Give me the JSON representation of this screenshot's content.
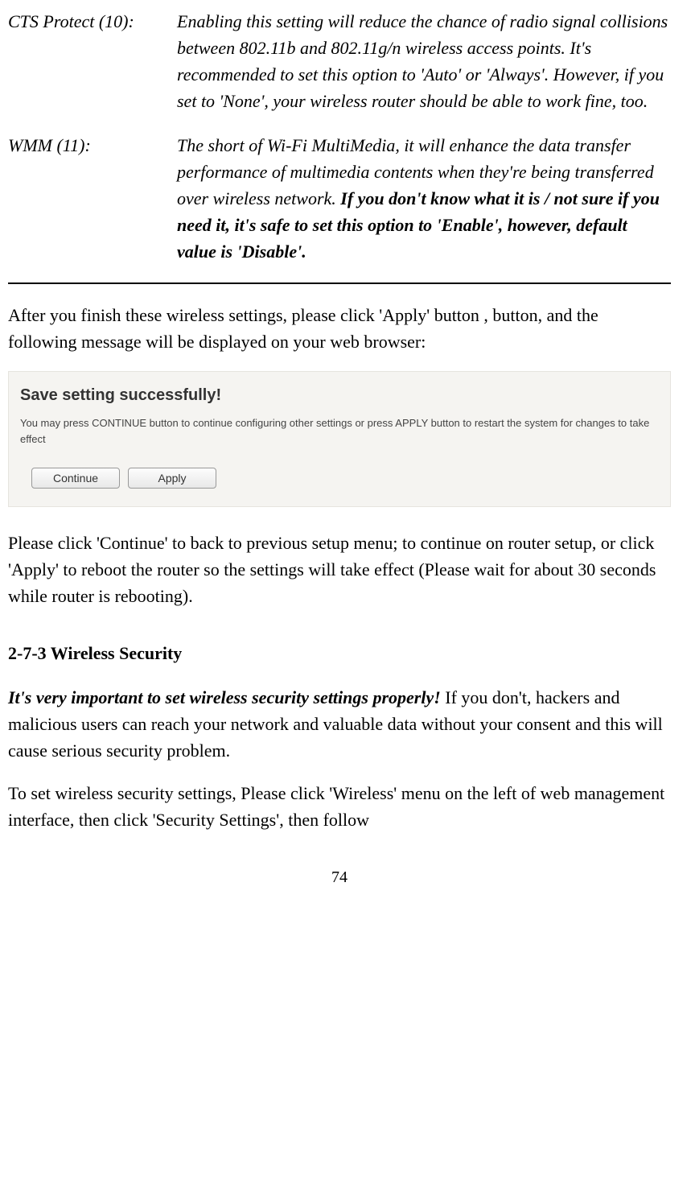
{
  "defs": {
    "cts": {
      "label": "CTS Protect (10):",
      "body": "Enabling this setting will reduce the chance of radio signal collisions between 802.11b and 802.11g/n wireless access points. It's recommended to set this option to 'Auto' or 'Always'. However, if you set to 'None', your wireless router should be able to work fine, too."
    },
    "wmm": {
      "label": "WMM (11):",
      "body_plain": "The short of Wi-Fi MultiMedia, it will enhance the data transfer performance of multimedia contents when they're being transferred over wireless network. ",
      "body_bold": "If you don't know what it is / not sure if you need it, it's safe to set this option to 'Enable', however, default value is 'Disable'."
    }
  },
  "para1": "After you finish these wireless settings, please click 'Apply' button , button, and the following message will be displayed on your web browser:",
  "panel": {
    "title": "Save setting successfully!",
    "text": "You may press CONTINUE button to continue configuring other settings or press APPLY button to restart the system for changes to take effect",
    "continue_label": "Continue",
    "apply_label": "Apply"
  },
  "para2": "Please click 'Continue' to back to previous setup menu; to continue on router setup, or click 'Apply' to reboot the router so the settings will take effect (Please wait for about 30 seconds while router is rebooting).",
  "section_heading": "2-7-3 Wireless Security",
  "para3_bold": "It's very important to set wireless security settings properly!",
  "para3_rest": " If you don't, hackers and malicious users can reach your network and valuable data without your consent and this will cause serious security problem.",
  "para4": "To set wireless security settings, Please click 'Wireless' menu on the left of web management interface, then click 'Security Settings', then follow",
  "page_number": "74"
}
